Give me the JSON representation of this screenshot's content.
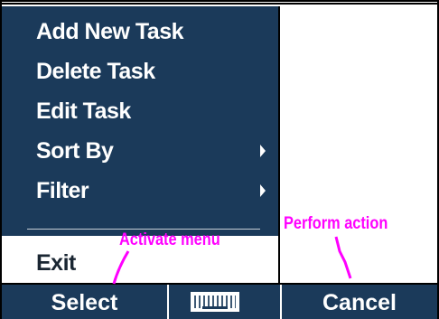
{
  "menu": {
    "items": [
      {
        "label": "Add New Task",
        "has_submenu": false
      },
      {
        "label": "Delete Task",
        "has_submenu": false
      },
      {
        "label": "Edit Task",
        "has_submenu": false
      },
      {
        "label": "Sort By",
        "has_submenu": true
      },
      {
        "label": "Filter",
        "has_submenu": true
      }
    ],
    "exit_label": "Exit"
  },
  "softkeys": {
    "left_label": "Select",
    "right_label": "Cancel",
    "input_icon": "keyboard-icon"
  },
  "annotations": {
    "activate_menu": "Activate menu",
    "perform_action": "Perform action"
  },
  "colors": {
    "menu_background": "#1b3a5a",
    "menu_text": "#ffffff",
    "selected_background": "#ffffff",
    "annotation": "#ff00ff"
  }
}
